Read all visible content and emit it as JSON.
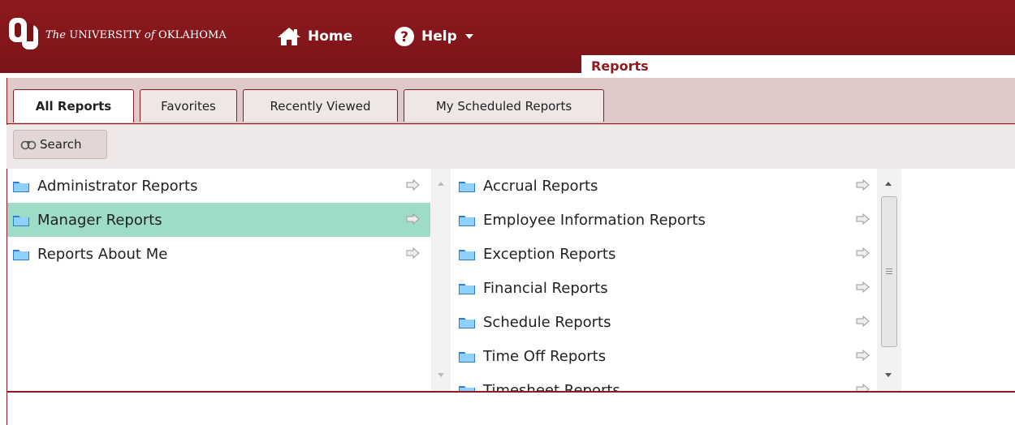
{
  "header": {
    "university_prefix": "The",
    "university_name": "UNIVERSITY",
    "university_of": "of",
    "university_state": "OKLAHOMA",
    "nav": {
      "home_label": "Home",
      "help_label": "Help"
    },
    "page_title": "Reports"
  },
  "tabs": [
    {
      "label": "All Reports"
    },
    {
      "label": "Favorites"
    },
    {
      "label": "Recently Viewed"
    },
    {
      "label": "My Scheduled Reports"
    }
  ],
  "toolbar": {
    "search_label": "Search"
  },
  "left_pane": {
    "items": [
      {
        "label": "Administrator Reports"
      },
      {
        "label": "Manager Reports",
        "selected": true
      },
      {
        "label": "Reports About Me"
      }
    ]
  },
  "right_pane": {
    "items": [
      {
        "label": "Accrual Reports"
      },
      {
        "label": "Employee Information Reports"
      },
      {
        "label": "Exception Reports"
      },
      {
        "label": "Financial Reports"
      },
      {
        "label": "Schedule Reports"
      },
      {
        "label": "Time Off Reports"
      },
      {
        "label": "Timesheet Reports"
      }
    ]
  },
  "colors": {
    "brand": "#8e1a1f",
    "selected_row": "#9fdcc7"
  },
  "icons": [
    "ou-logo-icon",
    "home-icon",
    "help-icon",
    "binoculars-icon",
    "folder-icon",
    "arrow-right-icon"
  ]
}
